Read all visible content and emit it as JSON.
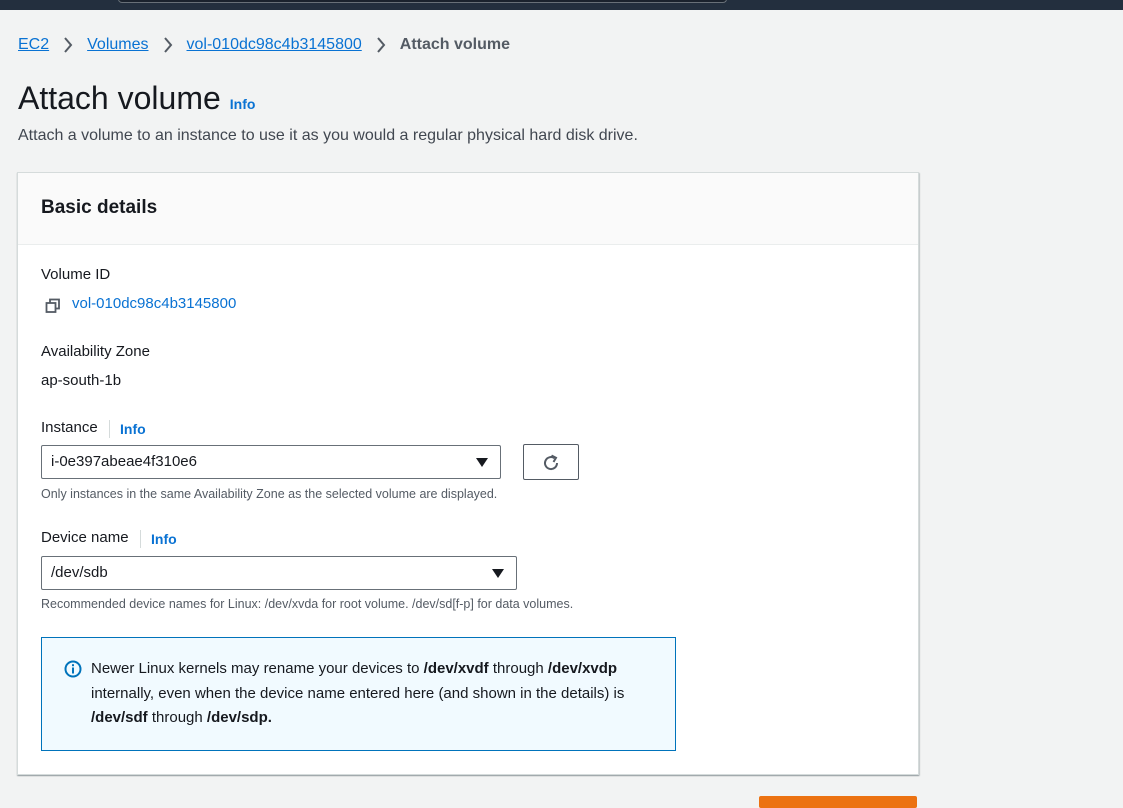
{
  "breadcrumb": {
    "items": [
      "EC2",
      "Volumes",
      "vol-010dc98c4b3145800"
    ],
    "current": "Attach volume"
  },
  "page": {
    "title": "Attach volume",
    "info": "Info",
    "subtitle": "Attach a volume to an instance to use it as you would a regular physical hard disk drive."
  },
  "panel": {
    "title": "Basic details",
    "volume_id_label": "Volume ID",
    "volume_id": "vol-010dc98c4b3145800",
    "az_label": "Availability Zone",
    "az_value": "ap-south-1b",
    "instance_label": "Instance",
    "instance_info": "Info",
    "instance_value": "i-0e397abeae4f310e6",
    "instance_hint": "Only instances in the same Availability Zone as the selected volume are displayed.",
    "device_label": "Device name",
    "device_info": "Info",
    "device_value": "/dev/sdb",
    "device_hint": "Recommended device names for Linux: /dev/xvda for root volume. /dev/sd[f-p] for data volumes."
  },
  "alert": {
    "t1": "Newer Linux kernels may rename your devices to ",
    "b1": "/dev/xvdf",
    "t2": " through ",
    "b2": "/dev/xvdp",
    "t3": " internally, even when the device name entered here (and shown in the details) is ",
    "b3": "/dev/sdf",
    "t4": " through ",
    "b4": "/dev/sdp."
  },
  "icons": {
    "chevron": "chevron-right-icon",
    "copy": "copy-icon",
    "refresh": "refresh-icon",
    "caret": "caret-down-icon",
    "info": "info-circle-icon"
  },
  "colors": {
    "link": "#0972d3",
    "topbar": "#232f3e",
    "primary_button": "#ec7211",
    "alert_border": "#0073bb",
    "alert_bg": "#f1faff"
  }
}
